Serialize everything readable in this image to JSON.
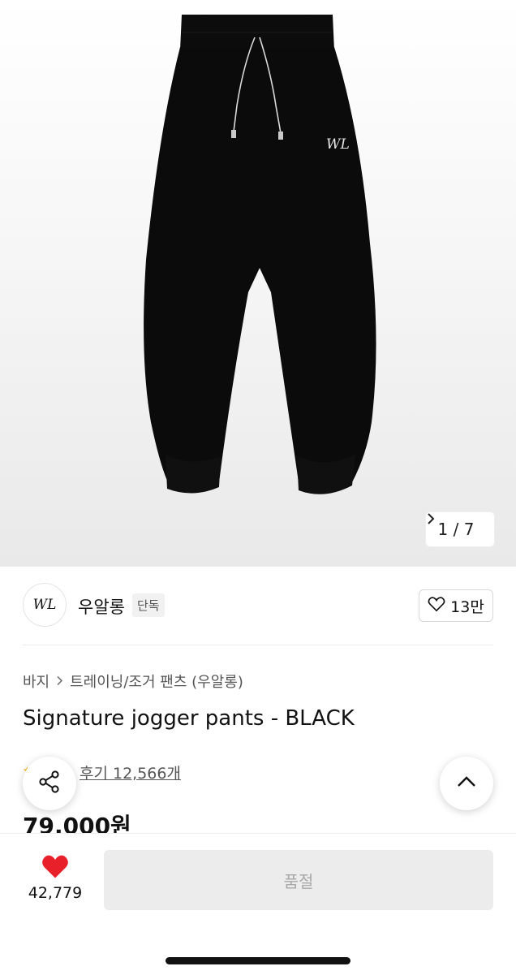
{
  "gallery": {
    "current": "1",
    "separator": "/",
    "total": "7"
  },
  "brand": {
    "logo_text": "WL",
    "name": "우알롱",
    "tag": "단독",
    "likes": "13만"
  },
  "breadcrumb": {
    "category": "바지",
    "subcategory": "트레이닝/조거 팬츠 (우알롱)"
  },
  "product": {
    "title": "Signature jogger pants - BLACK",
    "reviews": "후기 12,566개",
    "price": "79,000원"
  },
  "bottom": {
    "wish_count": "42,779",
    "buy_label": "품절"
  },
  "colors": {
    "heart": "#e8202a",
    "pants": "#0b0b0b",
    "soldout_bg": "#ececec"
  },
  "icons": [
    "chevron-right-icon",
    "heart-outline-icon",
    "share-icon",
    "chevron-up-icon",
    "heart-filled-icon"
  ]
}
